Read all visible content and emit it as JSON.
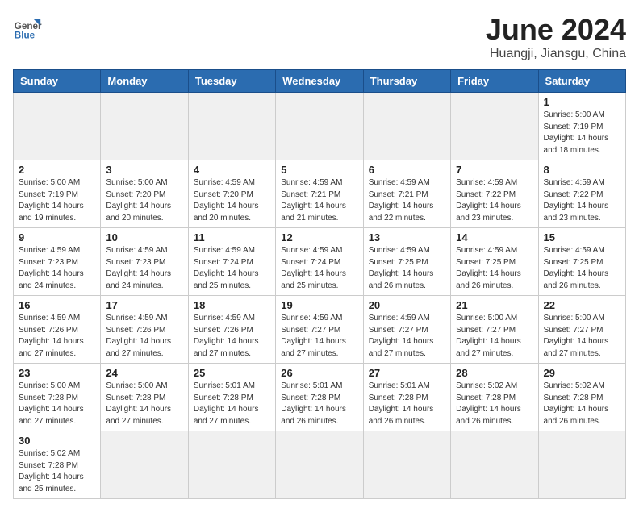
{
  "logo": {
    "text_general": "General",
    "text_blue": "Blue"
  },
  "header": {
    "month": "June 2024",
    "location": "Huangji, Jiansgu, China"
  },
  "days_of_week": [
    "Sunday",
    "Monday",
    "Tuesday",
    "Wednesday",
    "Thursday",
    "Friday",
    "Saturday"
  ],
  "weeks": [
    [
      {
        "day": "",
        "info": ""
      },
      {
        "day": "",
        "info": ""
      },
      {
        "day": "",
        "info": ""
      },
      {
        "day": "",
        "info": ""
      },
      {
        "day": "",
        "info": ""
      },
      {
        "day": "",
        "info": ""
      },
      {
        "day": "1",
        "info": "Sunrise: 5:00 AM\nSunset: 7:19 PM\nDaylight: 14 hours\nand 18 minutes."
      }
    ],
    [
      {
        "day": "2",
        "info": "Sunrise: 5:00 AM\nSunset: 7:19 PM\nDaylight: 14 hours\nand 19 minutes."
      },
      {
        "day": "3",
        "info": "Sunrise: 5:00 AM\nSunset: 7:20 PM\nDaylight: 14 hours\nand 20 minutes."
      },
      {
        "day": "4",
        "info": "Sunrise: 4:59 AM\nSunset: 7:20 PM\nDaylight: 14 hours\nand 20 minutes."
      },
      {
        "day": "5",
        "info": "Sunrise: 4:59 AM\nSunset: 7:21 PM\nDaylight: 14 hours\nand 21 minutes."
      },
      {
        "day": "6",
        "info": "Sunrise: 4:59 AM\nSunset: 7:21 PM\nDaylight: 14 hours\nand 22 minutes."
      },
      {
        "day": "7",
        "info": "Sunrise: 4:59 AM\nSunset: 7:22 PM\nDaylight: 14 hours\nand 23 minutes."
      },
      {
        "day": "8",
        "info": "Sunrise: 4:59 AM\nSunset: 7:22 PM\nDaylight: 14 hours\nand 23 minutes."
      }
    ],
    [
      {
        "day": "9",
        "info": "Sunrise: 4:59 AM\nSunset: 7:23 PM\nDaylight: 14 hours\nand 24 minutes."
      },
      {
        "day": "10",
        "info": "Sunrise: 4:59 AM\nSunset: 7:23 PM\nDaylight: 14 hours\nand 24 minutes."
      },
      {
        "day": "11",
        "info": "Sunrise: 4:59 AM\nSunset: 7:24 PM\nDaylight: 14 hours\nand 25 minutes."
      },
      {
        "day": "12",
        "info": "Sunrise: 4:59 AM\nSunset: 7:24 PM\nDaylight: 14 hours\nand 25 minutes."
      },
      {
        "day": "13",
        "info": "Sunrise: 4:59 AM\nSunset: 7:25 PM\nDaylight: 14 hours\nand 26 minutes."
      },
      {
        "day": "14",
        "info": "Sunrise: 4:59 AM\nSunset: 7:25 PM\nDaylight: 14 hours\nand 26 minutes."
      },
      {
        "day": "15",
        "info": "Sunrise: 4:59 AM\nSunset: 7:25 PM\nDaylight: 14 hours\nand 26 minutes."
      }
    ],
    [
      {
        "day": "16",
        "info": "Sunrise: 4:59 AM\nSunset: 7:26 PM\nDaylight: 14 hours\nand 27 minutes."
      },
      {
        "day": "17",
        "info": "Sunrise: 4:59 AM\nSunset: 7:26 PM\nDaylight: 14 hours\nand 27 minutes."
      },
      {
        "day": "18",
        "info": "Sunrise: 4:59 AM\nSunset: 7:26 PM\nDaylight: 14 hours\nand 27 minutes."
      },
      {
        "day": "19",
        "info": "Sunrise: 4:59 AM\nSunset: 7:27 PM\nDaylight: 14 hours\nand 27 minutes."
      },
      {
        "day": "20",
        "info": "Sunrise: 4:59 AM\nSunset: 7:27 PM\nDaylight: 14 hours\nand 27 minutes."
      },
      {
        "day": "21",
        "info": "Sunrise: 5:00 AM\nSunset: 7:27 PM\nDaylight: 14 hours\nand 27 minutes."
      },
      {
        "day": "22",
        "info": "Sunrise: 5:00 AM\nSunset: 7:27 PM\nDaylight: 14 hours\nand 27 minutes."
      }
    ],
    [
      {
        "day": "23",
        "info": "Sunrise: 5:00 AM\nSunset: 7:28 PM\nDaylight: 14 hours\nand 27 minutes."
      },
      {
        "day": "24",
        "info": "Sunrise: 5:00 AM\nSunset: 7:28 PM\nDaylight: 14 hours\nand 27 minutes."
      },
      {
        "day": "25",
        "info": "Sunrise: 5:01 AM\nSunset: 7:28 PM\nDaylight: 14 hours\nand 27 minutes."
      },
      {
        "day": "26",
        "info": "Sunrise: 5:01 AM\nSunset: 7:28 PM\nDaylight: 14 hours\nand 26 minutes."
      },
      {
        "day": "27",
        "info": "Sunrise: 5:01 AM\nSunset: 7:28 PM\nDaylight: 14 hours\nand 26 minutes."
      },
      {
        "day": "28",
        "info": "Sunrise: 5:02 AM\nSunset: 7:28 PM\nDaylight: 14 hours\nand 26 minutes."
      },
      {
        "day": "29",
        "info": "Sunrise: 5:02 AM\nSunset: 7:28 PM\nDaylight: 14 hours\nand 26 minutes."
      }
    ],
    [
      {
        "day": "30",
        "info": "Sunrise: 5:02 AM\nSunset: 7:28 PM\nDaylight: 14 hours\nand 25 minutes."
      },
      {
        "day": "",
        "info": ""
      },
      {
        "day": "",
        "info": ""
      },
      {
        "day": "",
        "info": ""
      },
      {
        "day": "",
        "info": ""
      },
      {
        "day": "",
        "info": ""
      },
      {
        "day": "",
        "info": ""
      }
    ]
  ]
}
